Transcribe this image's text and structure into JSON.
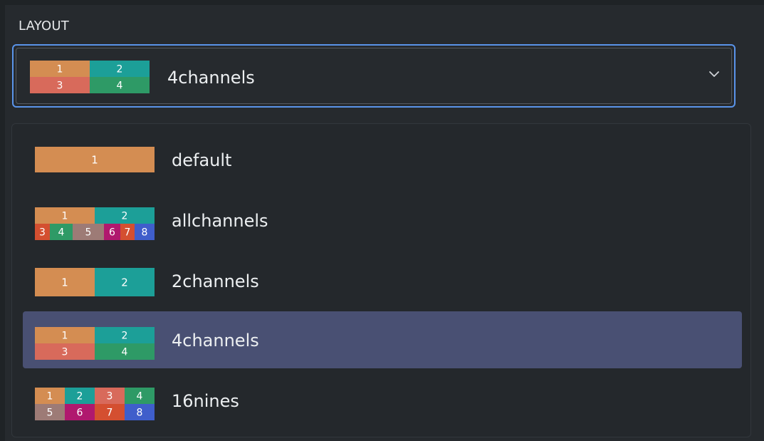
{
  "field_label": "LAYOUT",
  "select": {
    "selected_value": "4channels",
    "thumbnail": "4channels",
    "chevron_icon": "chevron-down-icon"
  },
  "options": [
    {
      "label": "default",
      "thumbnail": "default",
      "selected": false
    },
    {
      "label": "allchannels",
      "thumbnail": "allchannels",
      "selected": false
    },
    {
      "label": "2channels",
      "thumbnail": "2channels",
      "selected": false
    },
    {
      "label": "4channels",
      "thumbnail": "4channels",
      "selected": true
    },
    {
      "label": "16nines",
      "thumbnail": "16nines",
      "selected": false
    }
  ],
  "colors": {
    "orange": "#d48d52",
    "teal": "#1c9f98",
    "salmon": "#d86a5b",
    "green": "#2e9a66",
    "mauve": "#9d7b76",
    "magenta": "#b0186e",
    "red": "#d44f30",
    "blue": "#3f5ecb",
    "selected_row": "#495073",
    "focus_border": "#5a94ea"
  },
  "thumbnails": {
    "default": {
      "cells": [
        {
          "label": "1",
          "color": "orange"
        }
      ]
    },
    "2channels": {
      "cells": [
        {
          "label": "1",
          "color": "orange"
        },
        {
          "label": "2",
          "color": "teal"
        }
      ]
    },
    "4channels": {
      "cells": [
        {
          "label": "1",
          "color": "orange"
        },
        {
          "label": "2",
          "color": "teal"
        },
        {
          "label": "3",
          "color": "salmon"
        },
        {
          "label": "4",
          "color": "green"
        }
      ]
    },
    "allchannels": {
      "cells": [
        {
          "label": "1",
          "color": "orange"
        },
        {
          "label": "2",
          "color": "teal"
        },
        {
          "label": "3",
          "color": "red"
        },
        {
          "label": "4",
          "color": "green"
        },
        {
          "label": "5",
          "color": "mauve"
        },
        {
          "label": "6",
          "color": "magenta"
        },
        {
          "label": "7",
          "color": "red"
        },
        {
          "label": "8",
          "color": "blue"
        }
      ]
    },
    "16nines": {
      "cells": [
        {
          "label": "1",
          "color": "orange"
        },
        {
          "label": "2",
          "color": "teal"
        },
        {
          "label": "3",
          "color": "salmon"
        },
        {
          "label": "4",
          "color": "green"
        },
        {
          "label": "5",
          "color": "mauve"
        },
        {
          "label": "6",
          "color": "magenta"
        },
        {
          "label": "7",
          "color": "red"
        },
        {
          "label": "8",
          "color": "blue"
        }
      ]
    }
  }
}
